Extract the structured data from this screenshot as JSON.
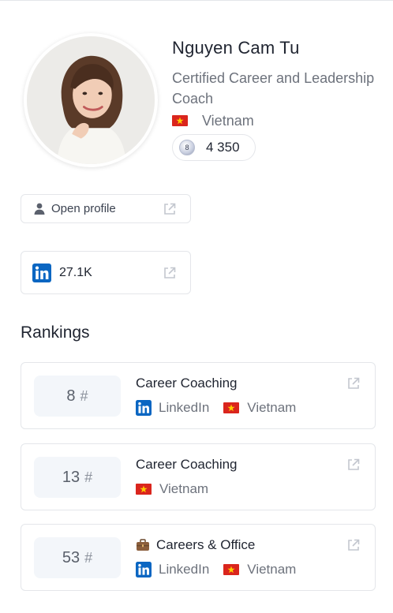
{
  "profile": {
    "name": "Nguyen Cam Tu",
    "title": "Certified Career and Leadership Coach",
    "country": "Vietnam",
    "score": "4 350",
    "medal_rank": "8"
  },
  "links": {
    "open_profile_label": "Open profile",
    "linkedin_followers": "27.1K"
  },
  "rankings": {
    "heading": "Rankings",
    "items": [
      {
        "rank": "8",
        "hash": "#",
        "category": "Career Coaching",
        "has_briefcase": false,
        "tags": [
          {
            "type": "linkedin",
            "label": "LinkedIn"
          },
          {
            "type": "country",
            "label": "Vietnam"
          }
        ]
      },
      {
        "rank": "13",
        "hash": "#",
        "category": "Career Coaching",
        "has_briefcase": false,
        "tags": [
          {
            "type": "country",
            "label": "Vietnam"
          }
        ]
      },
      {
        "rank": "53",
        "hash": "#",
        "category": "Careers & Office",
        "has_briefcase": true,
        "tags": [
          {
            "type": "linkedin",
            "label": "LinkedIn"
          },
          {
            "type": "country",
            "label": "Vietnam"
          }
        ]
      }
    ]
  },
  "colors": {
    "linkedin_blue": "#0a66c2",
    "vietnam_red": "#da251d",
    "vietnam_star": "#ffcd00",
    "muted_text": "#6d727c",
    "border": "#e4e6ea"
  },
  "icons": {
    "person": "person-icon",
    "external_link": "external-link-icon",
    "linkedin": "linkedin-icon",
    "briefcase": "briefcase-icon",
    "flag": "vietnam-flag-icon",
    "medal": "medal-icon"
  }
}
